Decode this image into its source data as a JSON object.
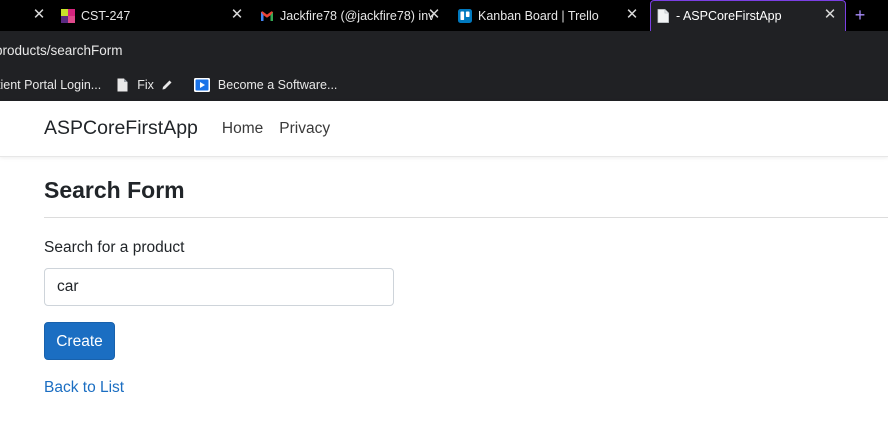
{
  "browser": {
    "tabs": [
      {
        "title": "",
        "icon": "blank-tab-icon",
        "active": false
      },
      {
        "title": "CST-247",
        "icon": "cst-247-favicon",
        "active": false
      },
      {
        "title": "Jackfire78 (@jackfire78) inv",
        "icon": "gmail-icon",
        "active": false
      },
      {
        "title": "Kanban Board | Trello",
        "icon": "trello-icon",
        "active": false
      },
      {
        "title": "- ASPCoreFirstApp",
        "icon": "page-icon",
        "active": true
      }
    ],
    "new_tab_label": "+",
    "close_glyph": "✕",
    "address": "products/searchForm",
    "bookmarks": [
      {
        "label": "tient Portal Login...",
        "icon": ""
      },
      {
        "label": "Fix",
        "icon": "document-icon"
      },
      {
        "label": "Become a Software...",
        "icon": "play-icon"
      }
    ]
  },
  "app": {
    "brand": "ASPCoreFirstApp",
    "nav": [
      {
        "label": "Home"
      },
      {
        "label": "Privacy"
      }
    ]
  },
  "page": {
    "heading": "Search Form",
    "search_label": "Search for a product",
    "search_value": "car",
    "submit_label": "Create",
    "back_link": "Back to List"
  },
  "colors": {
    "primary": "#1b6ec2",
    "tab_accent": "#7b3fe4",
    "chrome_bg": "#202124"
  }
}
